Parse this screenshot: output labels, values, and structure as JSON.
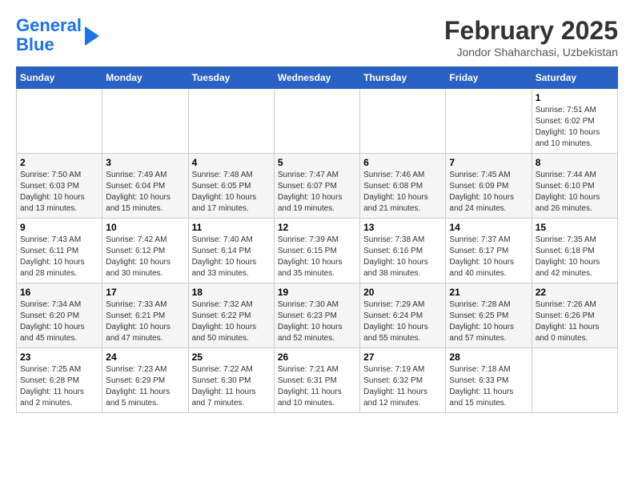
{
  "logo": {
    "line1": "General",
    "line2": "Blue"
  },
  "title": "February 2025",
  "subtitle": "Jondor Shaharchasi, Uzbekistan",
  "days_of_week": [
    "Sunday",
    "Monday",
    "Tuesday",
    "Wednesday",
    "Thursday",
    "Friday",
    "Saturday"
  ],
  "weeks": [
    [
      {
        "day": "",
        "info": ""
      },
      {
        "day": "",
        "info": ""
      },
      {
        "day": "",
        "info": ""
      },
      {
        "day": "",
        "info": ""
      },
      {
        "day": "",
        "info": ""
      },
      {
        "day": "",
        "info": ""
      },
      {
        "day": "1",
        "info": "Sunrise: 7:51 AM\nSunset: 6:02 PM\nDaylight: 10 hours and 10 minutes."
      }
    ],
    [
      {
        "day": "2",
        "info": "Sunrise: 7:50 AM\nSunset: 6:03 PM\nDaylight: 10 hours and 13 minutes."
      },
      {
        "day": "3",
        "info": "Sunrise: 7:49 AM\nSunset: 6:04 PM\nDaylight: 10 hours and 15 minutes."
      },
      {
        "day": "4",
        "info": "Sunrise: 7:48 AM\nSunset: 6:05 PM\nDaylight: 10 hours and 17 minutes."
      },
      {
        "day": "5",
        "info": "Sunrise: 7:47 AM\nSunset: 6:07 PM\nDaylight: 10 hours and 19 minutes."
      },
      {
        "day": "6",
        "info": "Sunrise: 7:46 AM\nSunset: 6:08 PM\nDaylight: 10 hours and 21 minutes."
      },
      {
        "day": "7",
        "info": "Sunrise: 7:45 AM\nSunset: 6:09 PM\nDaylight: 10 hours and 24 minutes."
      },
      {
        "day": "8",
        "info": "Sunrise: 7:44 AM\nSunset: 6:10 PM\nDaylight: 10 hours and 26 minutes."
      }
    ],
    [
      {
        "day": "9",
        "info": "Sunrise: 7:43 AM\nSunset: 6:11 PM\nDaylight: 10 hours and 28 minutes."
      },
      {
        "day": "10",
        "info": "Sunrise: 7:42 AM\nSunset: 6:12 PM\nDaylight: 10 hours and 30 minutes."
      },
      {
        "day": "11",
        "info": "Sunrise: 7:40 AM\nSunset: 6:14 PM\nDaylight: 10 hours and 33 minutes."
      },
      {
        "day": "12",
        "info": "Sunrise: 7:39 AM\nSunset: 6:15 PM\nDaylight: 10 hours and 35 minutes."
      },
      {
        "day": "13",
        "info": "Sunrise: 7:38 AM\nSunset: 6:16 PM\nDaylight: 10 hours and 38 minutes."
      },
      {
        "day": "14",
        "info": "Sunrise: 7:37 AM\nSunset: 6:17 PM\nDaylight: 10 hours and 40 minutes."
      },
      {
        "day": "15",
        "info": "Sunrise: 7:35 AM\nSunset: 6:18 PM\nDaylight: 10 hours and 42 minutes."
      }
    ],
    [
      {
        "day": "16",
        "info": "Sunrise: 7:34 AM\nSunset: 6:20 PM\nDaylight: 10 hours and 45 minutes."
      },
      {
        "day": "17",
        "info": "Sunrise: 7:33 AM\nSunset: 6:21 PM\nDaylight: 10 hours and 47 minutes."
      },
      {
        "day": "18",
        "info": "Sunrise: 7:32 AM\nSunset: 6:22 PM\nDaylight: 10 hours and 50 minutes."
      },
      {
        "day": "19",
        "info": "Sunrise: 7:30 AM\nSunset: 6:23 PM\nDaylight: 10 hours and 52 minutes."
      },
      {
        "day": "20",
        "info": "Sunrise: 7:29 AM\nSunset: 6:24 PM\nDaylight: 10 hours and 55 minutes."
      },
      {
        "day": "21",
        "info": "Sunrise: 7:28 AM\nSunset: 6:25 PM\nDaylight: 10 hours and 57 minutes."
      },
      {
        "day": "22",
        "info": "Sunrise: 7:26 AM\nSunset: 6:26 PM\nDaylight: 11 hours and 0 minutes."
      }
    ],
    [
      {
        "day": "23",
        "info": "Sunrise: 7:25 AM\nSunset: 6:28 PM\nDaylight: 11 hours and 2 minutes."
      },
      {
        "day": "24",
        "info": "Sunrise: 7:23 AM\nSunset: 6:29 PM\nDaylight: 11 hours and 5 minutes."
      },
      {
        "day": "25",
        "info": "Sunrise: 7:22 AM\nSunset: 6:30 PM\nDaylight: 11 hours and 7 minutes."
      },
      {
        "day": "26",
        "info": "Sunrise: 7:21 AM\nSunset: 6:31 PM\nDaylight: 11 hours and 10 minutes."
      },
      {
        "day": "27",
        "info": "Sunrise: 7:19 AM\nSunset: 6:32 PM\nDaylight: 11 hours and 12 minutes."
      },
      {
        "day": "28",
        "info": "Sunrise: 7:18 AM\nSunset: 6:33 PM\nDaylight: 11 hours and 15 minutes."
      },
      {
        "day": "",
        "info": ""
      }
    ]
  ]
}
